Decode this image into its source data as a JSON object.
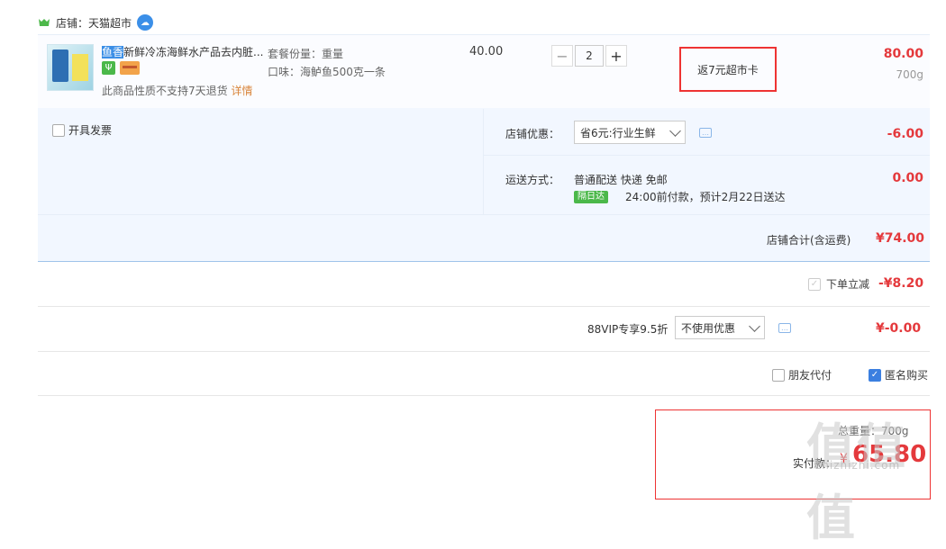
{
  "shop": {
    "label": "店铺：天猫超市"
  },
  "item": {
    "title_highlight": "鱼香",
    "title_rest": "新鲜冷冻海鲜水产品去内脏...",
    "notice": "此商品性质不支持7天退货",
    "notice_link": "详情",
    "spec_package": "套餐份量：重量",
    "spec_flavor": "口味：海鲈鱼500克一条",
    "unit_price": "40.00",
    "quantity": "2",
    "qty_minus": "−",
    "qty_plus": "+",
    "rebate": "返7元超市卡",
    "total_price": "80.00",
    "weight": "700g"
  },
  "options": {
    "invoice_label": "开具发票",
    "shop_discount_label": "店铺优惠：",
    "shop_discount_value": "省6元:行业生鲜",
    "shop_discount_amount": "-6.00",
    "shipping_label": "运送方式：",
    "shipping_method": "普通配送 快递 免邮",
    "next_day_badge": "隔日达",
    "delivery_note": "24:00前付款，预计2月22日送达",
    "shipping_amount": "0.00",
    "shop_total_label": "店铺合计(含运费)",
    "shop_total_value": "¥74.00"
  },
  "instant": {
    "label": "下单立减",
    "amount": "-¥8.20"
  },
  "vip": {
    "label": "88VIP专享9.5折",
    "select_value": "不使用优惠",
    "amount": "¥-0.00"
  },
  "extra": {
    "friend_pay": "朋友代付",
    "anonymous": "匿名购买"
  },
  "pay": {
    "weight_text": "总重量：700g",
    "label": "实付款：",
    "currency": "¥",
    "amount": "65.80"
  },
  "watermark": {
    "main": "值值值",
    "sub": "zhizhizhi.com"
  },
  "colors": {
    "accent_red": "#e4393c",
    "accent_blue": "#3b7fe0"
  }
}
